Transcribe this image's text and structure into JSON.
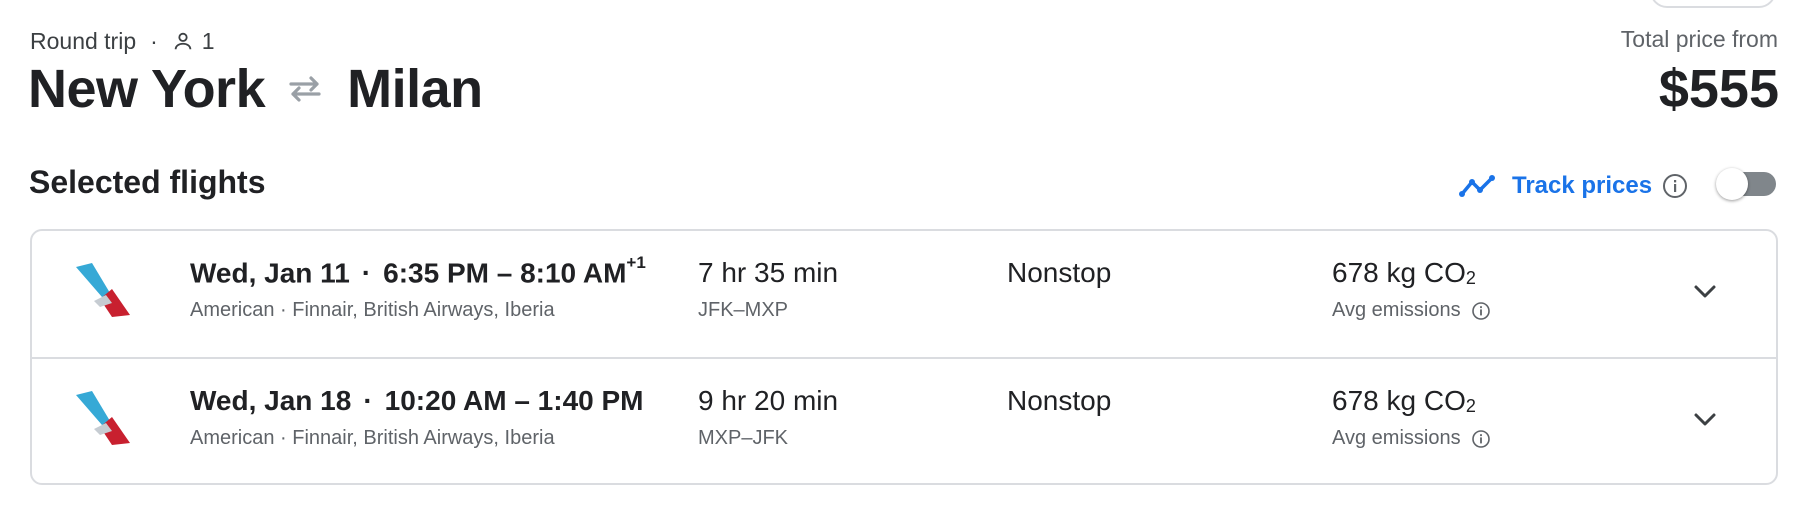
{
  "header": {
    "trip_type": "Round trip",
    "separator": "·",
    "passenger_icon": "person-icon",
    "passengers": "1",
    "origin": "New York",
    "swap_icon": "swap-arrows-icon",
    "destination": "Milan",
    "price_label": "Total price from",
    "price": "$555"
  },
  "selected": {
    "title": "Selected flights",
    "track_icon": "trend-line-icon",
    "track_label": "Track prices",
    "track_info_icon": "info-icon",
    "track_enabled": false
  },
  "flights": [
    {
      "date": "Wed, Jan 11",
      "separator": "·",
      "time_range": "6:35 PM – 8:10 AM",
      "day_offset": "+1",
      "carriers": "American · Finnair, British Airways, Iberia",
      "duration": "7 hr 35 min",
      "airports": "JFK–MXP",
      "stops": "Nonstop",
      "emissions_value": "678 kg CO",
      "emissions_sub": "2",
      "emissions_label": "Avg emissions"
    },
    {
      "date": "Wed, Jan 18",
      "separator": "·",
      "time_range": "10:20 AM – 1:40 PM",
      "day_offset": "",
      "carriers": "American · Finnair, British Airways, Iberia",
      "duration": "9 hr 20 min",
      "airports": "MXP–JFK",
      "stops": "Nonstop",
      "emissions_value": "678 kg CO",
      "emissions_sub": "2",
      "emissions_label": "Avg emissions"
    }
  ],
  "colors": {
    "accent": "#1a73e8",
    "text_primary": "#202124",
    "text_secondary": "#5f6368",
    "border": "#dadce0",
    "toggle_off": "#80868b",
    "airline_blue": "#36a9d6",
    "airline_red": "#c8202f"
  },
  "icons": {
    "airline_logo": "american-airlines-logo",
    "expand": "chevron-down-icon",
    "emissions_info": "info-icon"
  }
}
